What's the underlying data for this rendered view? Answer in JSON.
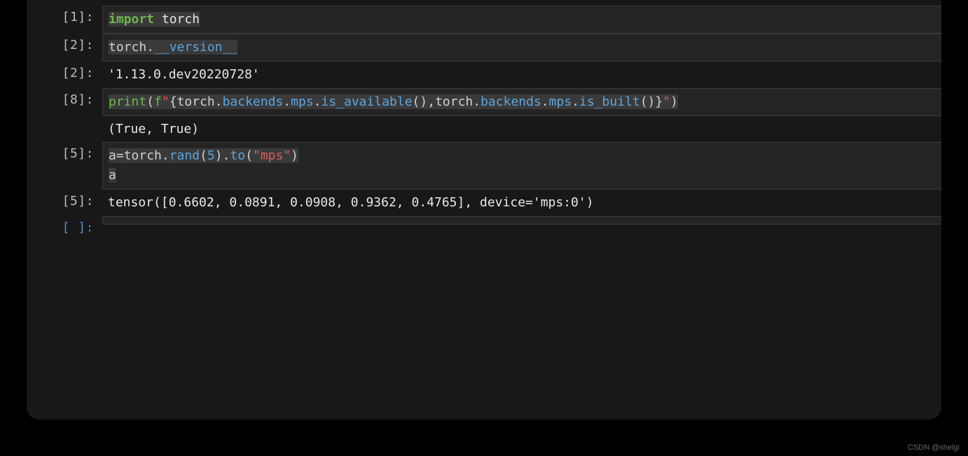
{
  "cells": [
    {
      "type": "code",
      "prompt": "[1]:",
      "lines": [
        [
          {
            "cls": "kw sel",
            "t": "import"
          },
          {
            "cls": "mod sel",
            "t": " torch"
          }
        ]
      ]
    },
    {
      "type": "code",
      "prompt": "[2]:",
      "lines": [
        [
          {
            "cls": "var sel",
            "t": "torch"
          },
          {
            "cls": "op sel",
            "t": "."
          },
          {
            "cls": "attr sel",
            "t": "__version__"
          }
        ]
      ]
    },
    {
      "type": "output",
      "prompt": "[2]:",
      "text": "'1.13.0.dev20220728'"
    },
    {
      "type": "code",
      "prompt": "[8]:",
      "lines": [
        [
          {
            "cls": "builtin sel",
            "t": "print"
          },
          {
            "cls": "paren sel",
            "t": "("
          },
          {
            "cls": "fstr-prefix sel",
            "t": "f"
          },
          {
            "cls": "str sel",
            "t": "\""
          },
          {
            "cls": "op sel",
            "t": "{"
          },
          {
            "cls": "var sel",
            "t": "torch"
          },
          {
            "cls": "op sel",
            "t": "."
          },
          {
            "cls": "attr sel",
            "t": "backends"
          },
          {
            "cls": "op sel",
            "t": "."
          },
          {
            "cls": "attr sel",
            "t": "mps"
          },
          {
            "cls": "op sel",
            "t": "."
          },
          {
            "cls": "attr sel",
            "t": "is_available"
          },
          {
            "cls": "paren sel",
            "t": "(),"
          },
          {
            "cls": "var sel",
            "t": "torch"
          },
          {
            "cls": "op sel",
            "t": "."
          },
          {
            "cls": "attr sel",
            "t": "backends"
          },
          {
            "cls": "op sel",
            "t": "."
          },
          {
            "cls": "attr sel",
            "t": "mps"
          },
          {
            "cls": "op sel",
            "t": "."
          },
          {
            "cls": "attr sel",
            "t": "is_built"
          },
          {
            "cls": "paren sel",
            "t": "()"
          },
          {
            "cls": "op sel",
            "t": "}"
          },
          {
            "cls": "str sel",
            "t": "\""
          },
          {
            "cls": "paren sel",
            "t": ")"
          }
        ]
      ],
      "output_inline": "(True, True)"
    },
    {
      "type": "code",
      "prompt": "[5]:",
      "lines": [
        [
          {
            "cls": "var sel",
            "t": "a"
          },
          {
            "cls": "op sel",
            "t": "="
          },
          {
            "cls": "var sel",
            "t": "torch"
          },
          {
            "cls": "op sel",
            "t": "."
          },
          {
            "cls": "attr sel",
            "t": "rand"
          },
          {
            "cls": "paren sel",
            "t": "("
          },
          {
            "cls": "num sel",
            "t": "5"
          },
          {
            "cls": "paren sel",
            "t": ")"
          },
          {
            "cls": "op sel",
            "t": "."
          },
          {
            "cls": "attr sel",
            "t": "to"
          },
          {
            "cls": "paren sel",
            "t": "("
          },
          {
            "cls": "str sel",
            "t": "\"mps\""
          },
          {
            "cls": "paren sel",
            "t": ")"
          }
        ],
        [
          {
            "cls": "var sel",
            "t": "a"
          }
        ]
      ]
    },
    {
      "type": "output",
      "prompt": "[5]:",
      "text": "tensor([0.6602, 0.0891, 0.0908, 0.9362, 0.4765], device='mps:0')"
    },
    {
      "type": "code",
      "prompt": "[ ]:",
      "prompt_empty": true,
      "lines": [
        [
          {
            "cls": "var",
            "t": " "
          }
        ]
      ]
    }
  ],
  "watermark": "CSDN @shelgi"
}
